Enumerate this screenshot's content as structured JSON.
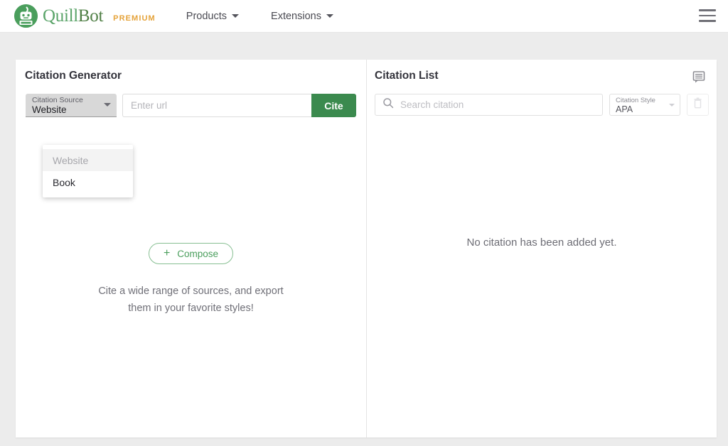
{
  "nav": {
    "brand": {
      "logo_icon": "quillbot-robot-icon",
      "name_part1": "Quill",
      "name_part2": "Bot",
      "badge": "PREMIUM"
    },
    "links": [
      {
        "label": "Products",
        "icon": "chevron-down-icon"
      },
      {
        "label": "Extensions",
        "icon": "chevron-down-icon"
      }
    ],
    "menu_icon": "hamburger-menu-icon"
  },
  "left_pane": {
    "title": "Citation Generator",
    "source_select": {
      "label": "Citation Source",
      "value": "Website",
      "icon": "chevron-down-icon",
      "open": true,
      "options": [
        {
          "label": "Website",
          "selected": true
        },
        {
          "label": "Book",
          "selected": false
        }
      ]
    },
    "url_input": {
      "placeholder": "Enter url",
      "value": ""
    },
    "cite_button": "Cite",
    "compose_button": {
      "label": "Compose",
      "icon": "plus-icon"
    },
    "tagline_line1": "Cite a wide range of sources, and export",
    "tagline_line2": "them in your favorite styles!"
  },
  "right_pane": {
    "title": "Citation List",
    "feedback_icon": "feedback-comment-icon",
    "search": {
      "icon": "search-icon",
      "placeholder": "Search citation",
      "value": ""
    },
    "style_select": {
      "label": "Citation Style",
      "value": "APA",
      "icon": "chevron-down-icon"
    },
    "delete_button_icon": "trash-icon",
    "empty_message": "No citation has been added yet."
  },
  "colors": {
    "brand_green": "#5aa469",
    "cite_green": "#3b8a4e",
    "premium_gold": "#e5a33a",
    "page_bg": "#ececec"
  }
}
